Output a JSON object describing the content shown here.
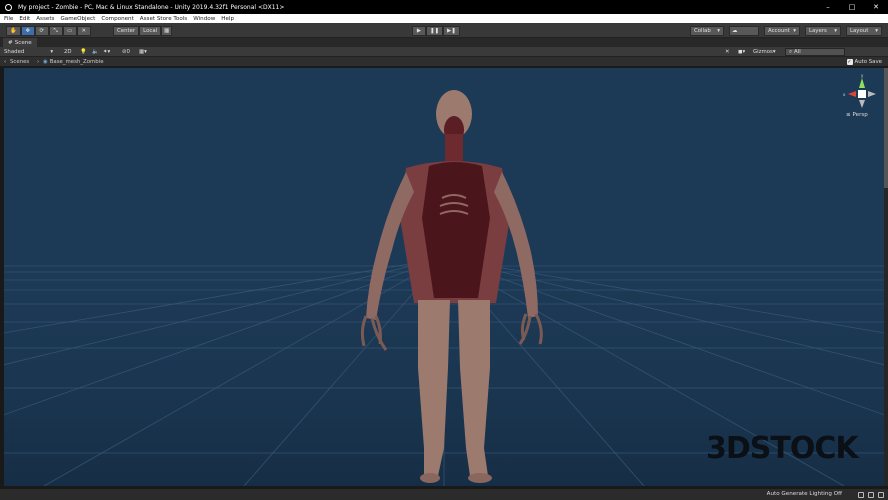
{
  "window": {
    "title": "My project - Zombie - PC, Mac & Linux Standalone - Unity 2019.4.32f1 Personal <DX11>",
    "controls": [
      "–",
      "□",
      "✕"
    ]
  },
  "menu": [
    "File",
    "Edit",
    "Assets",
    "GameObject",
    "Component",
    "Asset Store Tools",
    "Window",
    "Help"
  ],
  "toolbar": {
    "transform_tools": [
      "✋",
      "✥",
      "⟳",
      "⤡",
      "▭",
      "✕"
    ],
    "pivot_label": "Center",
    "space_label": "Local",
    "play_controls": [
      "▶",
      "❚❚",
      "▶❚"
    ],
    "collab_label": "Collab",
    "account_label": "Account",
    "layers_label": "Layers",
    "layout_label": "Layout"
  },
  "scene_tab": {
    "label": "Scene"
  },
  "scene_toolbar": {
    "shading_mode": "Shaded",
    "mode_2d": "2D",
    "fx_count": "0",
    "gizmos_label": "Gizmos",
    "search_placeholder": "All"
  },
  "breadcrumb": {
    "scenes_label": "Scenes",
    "prefab_label": "Base_mesh_Zombie",
    "auto_save_label": "Auto Save",
    "auto_save_checked": "✓"
  },
  "viewport": {
    "projection_label": "Persp",
    "gizmo_axes": {
      "y": "y",
      "x": "x",
      "z": "z"
    },
    "background_color": "#1c3955"
  },
  "watermark": {
    "text": "3DSTOCK"
  },
  "status": {
    "text": "Auto Generate Lighting Off"
  }
}
